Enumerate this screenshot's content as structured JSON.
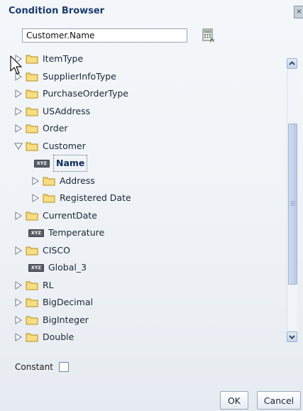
{
  "dialog": {
    "title": "Condition Browser",
    "close_glyph": "×"
  },
  "search": {
    "value": "Customer.Name"
  },
  "icons": {
    "calculator": "expression-builder-icon",
    "folder": "folder-icon",
    "element": "xyz-element-icon",
    "expander": "triangle-expander-icon"
  },
  "tree": {
    "items": [
      {
        "label": "ItemType",
        "kind": "folder",
        "state": "collapsed",
        "level": 0
      },
      {
        "label": "SupplierInfoType",
        "kind": "folder",
        "state": "collapsed",
        "level": 0
      },
      {
        "label": "PurchaseOrderType",
        "kind": "folder",
        "state": "collapsed",
        "level": 0
      },
      {
        "label": "USAddress",
        "kind": "folder",
        "state": "collapsed",
        "level": 0
      },
      {
        "label": "Order",
        "kind": "folder",
        "state": "collapsed",
        "level": 0
      },
      {
        "label": "Customer",
        "kind": "folder",
        "state": "expanded",
        "level": 0
      },
      {
        "label": "Name",
        "kind": "element",
        "state": "selected",
        "level": 1
      },
      {
        "label": "Address",
        "kind": "folder",
        "state": "collapsed",
        "level": 1
      },
      {
        "label": "Registered Date",
        "kind": "folder",
        "state": "collapsed",
        "level": 1
      },
      {
        "label": "CurrentDate",
        "kind": "folder",
        "state": "collapsed",
        "level": 0
      },
      {
        "label": "Temperature",
        "kind": "element",
        "state": "leaf",
        "level": 0
      },
      {
        "label": "CISCO",
        "kind": "folder",
        "state": "collapsed",
        "level": 0
      },
      {
        "label": "Global_3",
        "kind": "element",
        "state": "leaf",
        "level": 0
      },
      {
        "label": "RL",
        "kind": "folder",
        "state": "collapsed",
        "level": 0
      },
      {
        "label": "BigDecimal",
        "kind": "folder",
        "state": "collapsed",
        "level": 0
      },
      {
        "label": "BigInteger",
        "kind": "folder",
        "state": "collapsed",
        "level": 0
      },
      {
        "label": "Double",
        "kind": "folder",
        "state": "collapsed",
        "level": 0
      }
    ]
  },
  "constant": {
    "label": "Constant",
    "checked": false
  },
  "buttons": {
    "ok": "OK",
    "cancel": "Cancel"
  },
  "colors": {
    "title": "#1c3d70",
    "folder": "#e8c14a",
    "selection_text": "#0d2a5c"
  }
}
